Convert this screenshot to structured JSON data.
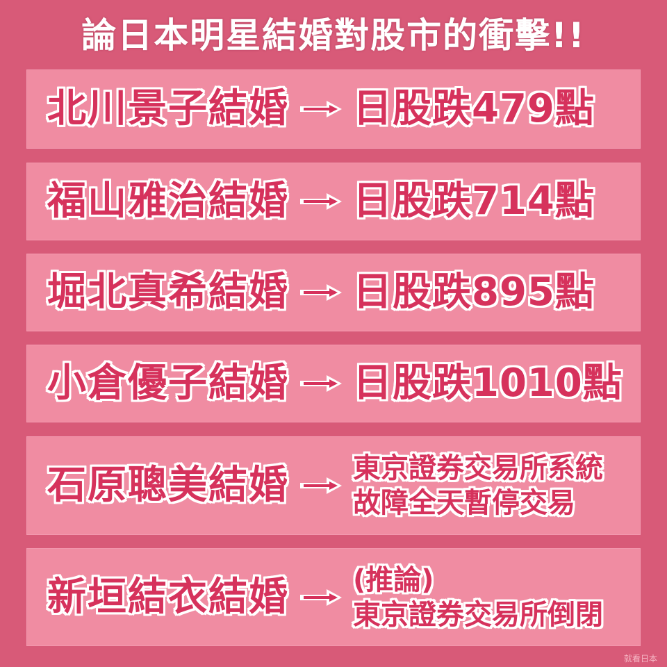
{
  "title": "論日本明星結婚對股市的衝擊!!",
  "colors": {
    "background": "#d85a78",
    "panel": "#f08ca2",
    "text": "#d6325c",
    "outline": "#ffffff"
  },
  "arrow_icon": "right-arrow-icon",
  "rows": [
    {
      "cause": "北川景子結婚",
      "effect": "日股跌479點"
    },
    {
      "cause": "福山雅治結婚",
      "effect": "日股跌714點"
    },
    {
      "cause": "堀北真希結婚",
      "effect": "日股跌895點"
    },
    {
      "cause": "小倉優子結婚",
      "effect": "日股跌1010點"
    },
    {
      "cause": "石原聰美結婚",
      "effect_lines": [
        "東京證券交易所系統",
        "故障全天暫停交易"
      ]
    },
    {
      "cause": "新垣結衣結婚",
      "effect_lines": [
        "(推論)",
        "東京證券交易所倒閉"
      ]
    }
  ],
  "watermark": "就看日本"
}
